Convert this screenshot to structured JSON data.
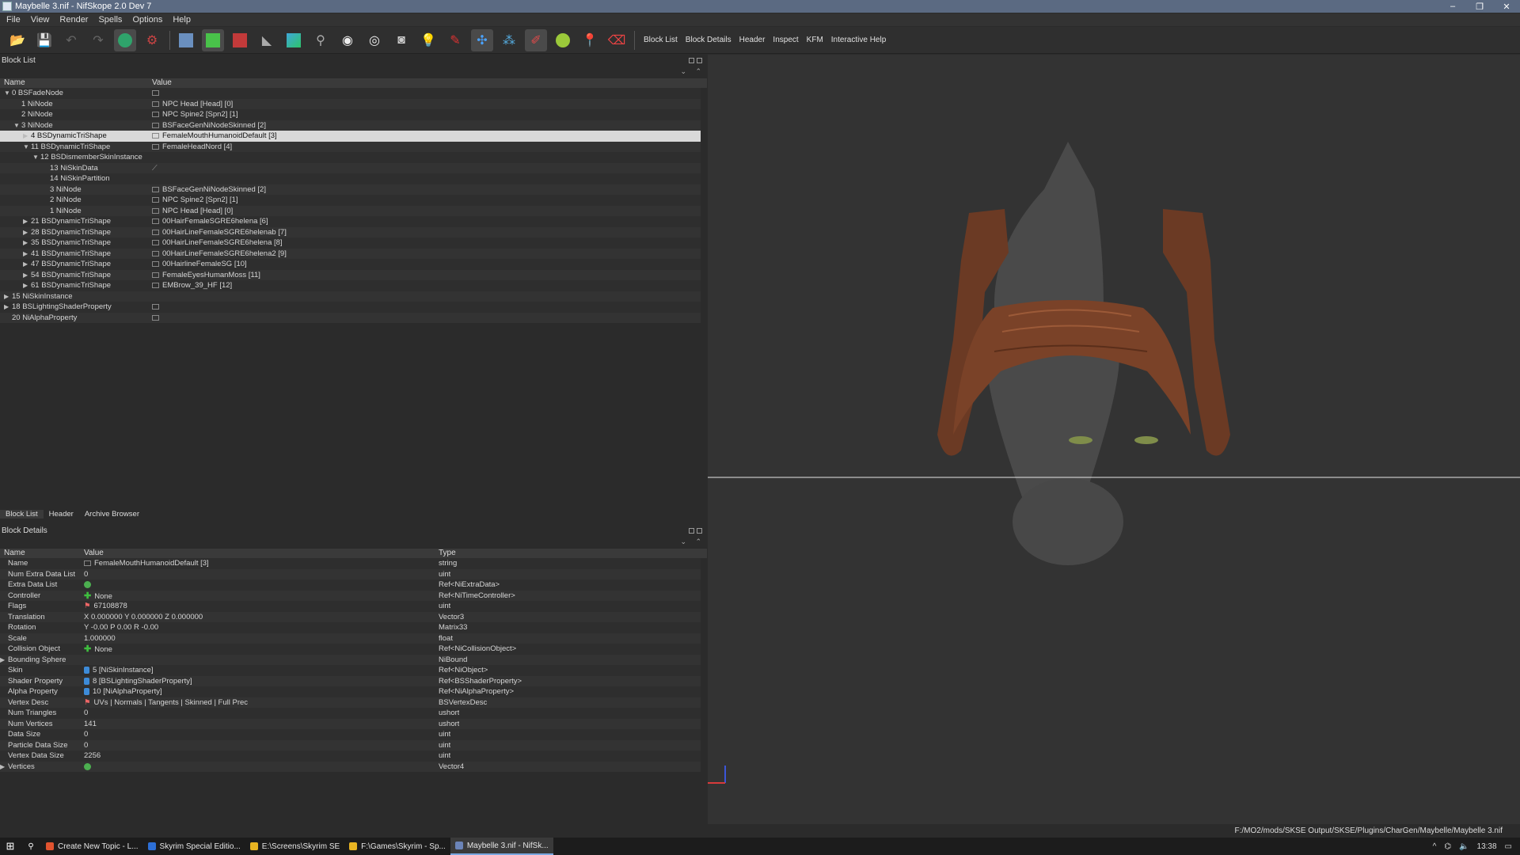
{
  "window": {
    "title": "Maybelle 3.nif - NifSkope 2.0 Dev 7",
    "controls": [
      "–",
      "❐",
      "✕"
    ]
  },
  "menu": [
    "File",
    "View",
    "Render",
    "Spells",
    "Options",
    "Help"
  ],
  "toolbar": {
    "icons": [
      "open-icon",
      "save-icon",
      "undo-icon",
      "redo-icon",
      "select-icon",
      "transform-icon",
      "cube-icon",
      "solid-icon",
      "texture-icon",
      "walk-icon",
      "axes-icon",
      "skeleton-icon",
      "eye-icon",
      "eye-alt-icon",
      "camera-icon",
      "bulb-icon",
      "pen-icon",
      "gizmo-icon",
      "nodes-icon",
      "paint-icon",
      "smiley-icon",
      "marker-icon",
      "eraser-icon"
    ],
    "text_buttons": [
      "Block List",
      "Block Details",
      "Header",
      "Inspect",
      "KFM",
      "Interactive Help"
    ]
  },
  "block_list": {
    "title": "Block List",
    "columns": [
      "Name",
      "Value"
    ],
    "rows": [
      {
        "depth": 0,
        "arrow": "▼",
        "name": "0 BSFadeNode",
        "icon": "vicon",
        "value": ""
      },
      {
        "depth": 1,
        "arrow": "",
        "name": "1 NiNode",
        "icon": "vicon",
        "value": "NPC Head [Head] [0]"
      },
      {
        "depth": 1,
        "arrow": "",
        "name": "2 NiNode",
        "icon": "vicon",
        "value": "NPC Spine2 [Spn2] [1]"
      },
      {
        "depth": 1,
        "arrow": "▼",
        "name": "3 NiNode",
        "icon": "vicon",
        "value": "BSFaceGenNiNodeSkinned [2]"
      },
      {
        "depth": 2,
        "arrow": "▶",
        "name": "4 BSDynamicTriShape",
        "icon": "vicon",
        "value": "FemaleMouthHumanoidDefault [3]",
        "selected": true
      },
      {
        "depth": 2,
        "arrow": "▼",
        "name": "11 BSDynamicTriShape",
        "icon": "vicon",
        "value": "FemaleHeadNord [4]"
      },
      {
        "depth": 3,
        "arrow": "▼",
        "name": "12 BSDismemberSkinInstance",
        "icon": "",
        "value": ""
      },
      {
        "depth": 4,
        "arrow": "",
        "name": "13 NiSkinData",
        "icon": "link",
        "value": ""
      },
      {
        "depth": 4,
        "arrow": "",
        "name": "14 NiSkinPartition",
        "icon": "",
        "value": ""
      },
      {
        "depth": 4,
        "arrow": "",
        "name": "3 NiNode",
        "icon": "vicon",
        "value": "BSFaceGenNiNodeSkinned [2]"
      },
      {
        "depth": 4,
        "arrow": "",
        "name": "2 NiNode",
        "icon": "vicon",
        "value": "NPC Spine2 [Spn2] [1]"
      },
      {
        "depth": 4,
        "arrow": "",
        "name": "1 NiNode",
        "icon": "vicon",
        "value": "NPC Head [Head] [0]"
      },
      {
        "depth": 2,
        "arrow": "▶",
        "name": "21 BSDynamicTriShape",
        "icon": "vicon",
        "value": "00HairFemaleSGRE6helena [6]"
      },
      {
        "depth": 2,
        "arrow": "▶",
        "name": "28 BSDynamicTriShape",
        "icon": "vicon",
        "value": "00HairLineFemaleSGRE6helenab [7]"
      },
      {
        "depth": 2,
        "arrow": "▶",
        "name": "35 BSDynamicTriShape",
        "icon": "vicon",
        "value": "00HairLineFemaleSGRE6helena [8]"
      },
      {
        "depth": 2,
        "arrow": "▶",
        "name": "41 BSDynamicTriShape",
        "icon": "vicon",
        "value": "00HairLineFemaleSGRE6helena2 [9]"
      },
      {
        "depth": 2,
        "arrow": "▶",
        "name": "47 BSDynamicTriShape",
        "icon": "vicon",
        "value": "00HairlineFemaleSG [10]"
      },
      {
        "depth": 2,
        "arrow": "▶",
        "name": "54 BSDynamicTriShape",
        "icon": "vicon",
        "value": "FemaleEyesHumanMoss [11]"
      },
      {
        "depth": 2,
        "arrow": "▶",
        "name": "61 BSDynamicTriShape",
        "icon": "vicon",
        "value": "EMBrow_39_HF [12]"
      },
      {
        "depth": 0,
        "arrow": "▶",
        "name": "15 NiSkinInstance",
        "icon": "",
        "value": ""
      },
      {
        "depth": 0,
        "arrow": "▶",
        "name": "18 BSLightingShaderProperty",
        "icon": "vicon",
        "value": ""
      },
      {
        "depth": 0,
        "arrow": "",
        "name": "20 NiAlphaProperty",
        "icon": "vicon",
        "value": ""
      }
    ],
    "tabs": [
      "Block List",
      "Header",
      "Archive Browser"
    ]
  },
  "block_details": {
    "title": "Block Details",
    "columns": [
      "Name",
      "Value",
      "Type"
    ],
    "rows": [
      {
        "arrow": "",
        "name": "Name",
        "icon": "vicon",
        "value": "FemaleMouthHumanoidDefault [3]",
        "type": "string"
      },
      {
        "arrow": "",
        "name": "Num Extra Data List",
        "icon": "",
        "value": "0",
        "type": "uint"
      },
      {
        "arrow": "",
        "name": "Extra Data List",
        "icon": "gicon",
        "value": "",
        "type": "Ref<NiExtraData>"
      },
      {
        "arrow": "",
        "name": "Controller",
        "icon": "plus",
        "value": "None",
        "type": "Ref<NiTimeController>"
      },
      {
        "arrow": "",
        "name": "Flags",
        "icon": "flag",
        "value": "67108878",
        "type": "uint"
      },
      {
        "arrow": "",
        "name": "Translation",
        "icon": "",
        "value": "X 0.000000 Y 0.000000 Z 0.000000",
        "type": "Vector3"
      },
      {
        "arrow": "",
        "name": "Rotation",
        "icon": "",
        "value": "Y -0.00 P 0.00 R -0.00",
        "type": "Matrix33"
      },
      {
        "arrow": "",
        "name": "Scale",
        "icon": "",
        "value": "1.000000",
        "type": "float"
      },
      {
        "arrow": "",
        "name": "Collision Object",
        "icon": "plus",
        "value": "None",
        "type": "Ref<NiCollisionObject>"
      },
      {
        "arrow": "▶",
        "name": "Bounding Sphere",
        "icon": "",
        "value": "",
        "type": "NiBound"
      },
      {
        "arrow": "",
        "name": "Skin",
        "icon": "bicon",
        "value": "5 [NiSkinInstance]",
        "type": "Ref<NiObject>"
      },
      {
        "arrow": "",
        "name": "Shader Property",
        "icon": "bicon",
        "value": "8 [BSLightingShaderProperty]",
        "type": "Ref<BSShaderProperty>"
      },
      {
        "arrow": "",
        "name": "Alpha Property",
        "icon": "bicon",
        "value": "10 [NiAlphaProperty]",
        "type": "Ref<NiAlphaProperty>"
      },
      {
        "arrow": "",
        "name": "Vertex Desc",
        "icon": "flag",
        "value": "UVs | Normals | Tangents | Skinned | Full Prec",
        "type": "BSVertexDesc"
      },
      {
        "arrow": "",
        "name": "Num Triangles",
        "icon": "",
        "value": "0",
        "type": "ushort"
      },
      {
        "arrow": "",
        "name": "Num Vertices",
        "icon": "",
        "value": "141",
        "type": "ushort"
      },
      {
        "arrow": "",
        "name": "Data Size",
        "icon": "",
        "value": "0",
        "type": "uint"
      },
      {
        "arrow": "",
        "name": "Particle Data Size",
        "icon": "",
        "value": "0",
        "type": "uint"
      },
      {
        "arrow": "",
        "name": "Vertex Data Size",
        "icon": "",
        "value": "2256",
        "type": "uint"
      },
      {
        "arrow": "▶",
        "name": "Vertices",
        "icon": "gicon",
        "value": "",
        "type": "Vector4"
      }
    ]
  },
  "status": {
    "path": "F:/MO2/mods/SKSE Output/SKSE/Plugins/CharGen/Maybelle/Maybelle 3.nif"
  },
  "taskbar": {
    "items": [
      {
        "label": "Create New Topic - L...",
        "color": "#e0532f"
      },
      {
        "label": "Skyrim Special Editio...",
        "color": "#2d6fd6"
      },
      {
        "label": "E:\\Screens\\Skyrim SE",
        "color": "#e8b422"
      },
      {
        "label": "F:\\Games\\Skyrim - Sp...",
        "color": "#e8b422"
      },
      {
        "label": "Maybelle 3.nif - NifSk...",
        "color": "#6b84b8",
        "active": true
      }
    ],
    "clock": "13:38"
  },
  "colors": {
    "selection": "#d9d9d9",
    "hair": "#6b3a24",
    "head": "#4a4a4a"
  }
}
